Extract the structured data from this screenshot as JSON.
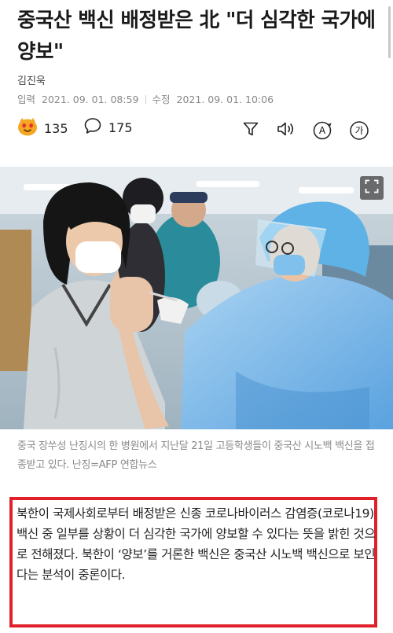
{
  "article": {
    "headline": "중국산 백신 배정받은 北 \"더 심각한 국가에 양보\"",
    "author": "김진욱",
    "published_label": "입력",
    "published": "2021. 09. 01. 08:59",
    "modified_label": "수정",
    "modified": "2021. 09. 01. 10:06"
  },
  "actions": {
    "reaction_count": "135",
    "comment_count": "175",
    "tools": [
      "filter-icon",
      "speaker-icon",
      "translate-icon",
      "font-size-icon"
    ],
    "translate_glyph": "A",
    "font_glyph": "가"
  },
  "photo": {
    "caption": "중국 장쑤성 난징시의 한 병원에서 지난달 21일 고등학생들이 중국산 시노백 백신을 접종받고 있다. 난징=AFP 연합뉴스"
  },
  "body": {
    "paragraph": "북한이 국제사회로부터 배정받은 신종 코로나바이러스 감염증(코로나19) 백신 중 일부를 상황이 더 심각한 국가에 양보할 수 있다는 뜻을 밝힌 것으로 전해졌다. 북한이 ‘양보’를 거론한 백신은 중국산 시노백 백신으로 보인다는 분석이 중론이다."
  },
  "colors": {
    "highlight_border": "#e0212b",
    "headline": "#1a1a1a",
    "meta": "#888888"
  }
}
